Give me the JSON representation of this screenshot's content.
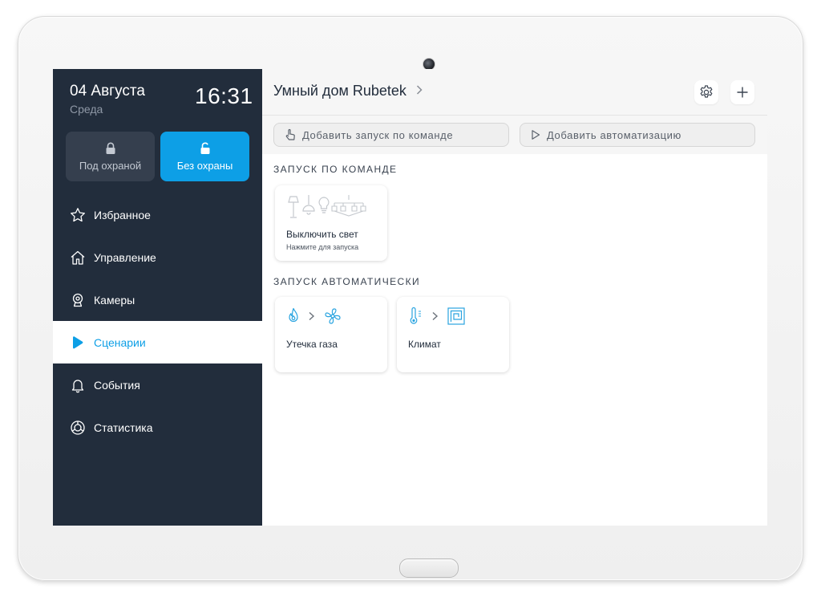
{
  "device": {
    "camera_icon": "front-camera",
    "home_button_icon": "home-button"
  },
  "sidebar": {
    "date": "04 Августа",
    "weekday": "Среда",
    "time": "16:31",
    "security": {
      "armed_label": "Под охраной",
      "armed_icon": "lock-closed-icon",
      "disarmed_label": "Без охраны",
      "disarmed_icon": "lock-open-icon",
      "active": "disarmed",
      "accent": "#0d9fe6"
    },
    "items": [
      {
        "label": "Избранное",
        "icon": "star-icon"
      },
      {
        "label": "Управление",
        "icon": "house-icon"
      },
      {
        "label": "Камеры",
        "icon": "camera-icon"
      },
      {
        "label": "Сценарии",
        "icon": "play-icon",
        "active": true
      },
      {
        "label": "События",
        "icon": "bell-icon"
      },
      {
        "label": "Статистика",
        "icon": "chart-ring-icon"
      }
    ],
    "background": "#222d3c"
  },
  "header": {
    "title": "Умный дом Rubetek",
    "title_chevron": "chevron-right-icon",
    "settings_icon": "gear-icon",
    "add_icon": "plus-icon"
  },
  "actions": {
    "add_command_label": "Добавить запуск по команде",
    "add_automation_label": "Добавить автоматизацию"
  },
  "sections": {
    "command_title": "ЗАПУСК ПО КОМАНДЕ",
    "auto_title": "ЗАПУСК АВТОМАТИЧЕСКИ"
  },
  "command_scenarios": [
    {
      "name": "Выключить свет",
      "hint": "Нажмите для запуска",
      "icons": [
        "floor-lamp-icon",
        "pendant-lamp-icon",
        "bulb-icon",
        "chandelier-icon"
      ]
    }
  ],
  "auto_scenarios": [
    {
      "name": "Утечка газа",
      "trigger_icon": "flame-icon",
      "action_icon": "fan-icon"
    },
    {
      "name": "Климат",
      "trigger_icon": "thermometer-icon",
      "action_icon": "heating-floor-icon"
    }
  ]
}
